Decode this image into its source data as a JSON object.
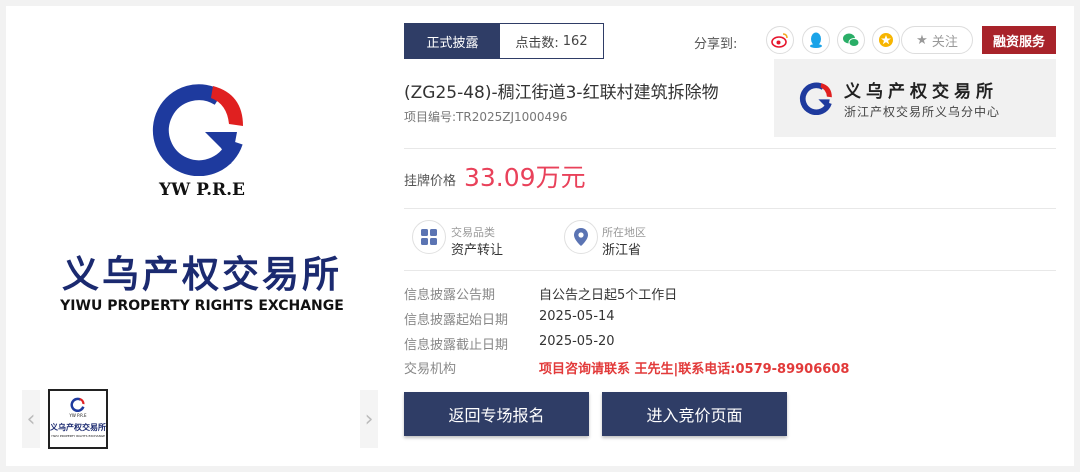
{
  "main_logo": {
    "abbr": "YW P.R.E",
    "name_cn": "义乌产权交易所",
    "name_en": "YIWU PROPERTY RIGHTS EXCHANGE"
  },
  "thumb": {
    "abbr": "YW P.R.E",
    "name_cn": "义乌产权交易所",
    "name_en": "YIWU PROPERTY RIGHTS EXCHANGE"
  },
  "status": {
    "label": "正式披露",
    "click_label": "点击数:",
    "click_count": "162"
  },
  "share": {
    "label": "分享到:",
    "follow_label": "关注",
    "finance_label": "融资服务"
  },
  "project": {
    "title": "(ZG25-48)-稠江街道3-红联村建筑拆除物",
    "number": "项目编号:TR2025ZJ1000496"
  },
  "org": {
    "name": "义乌产权交易所",
    "sub": "浙江产权交易所义乌分中心"
  },
  "price": {
    "label": "挂牌价格",
    "value": "33.09万元"
  },
  "attributes": [
    {
      "label": "交易品类",
      "value": "资产转让"
    },
    {
      "label": "所在地区",
      "value": "浙江省"
    }
  ],
  "info": [
    {
      "label": "信息披露公告期",
      "value": "自公告之日起5个工作日"
    },
    {
      "label": "信息披露起始日期",
      "value": "2025-05-14"
    },
    {
      "label": "信息披露截止日期",
      "value": "2025-05-20"
    },
    {
      "label": "交易机构",
      "value": "项目咨询请联系 王先生|联系电话:0579-89906608"
    }
  ],
  "buttons": {
    "back": "返回专场报名",
    "enter": "进入竞价页面"
  },
  "colors": {
    "navy": "#2f3d66",
    "price_red": "#e9415a",
    "logo_blue": "#1e3a9e",
    "logo_red": "#e02020",
    "finance_red": "#a8232a"
  }
}
